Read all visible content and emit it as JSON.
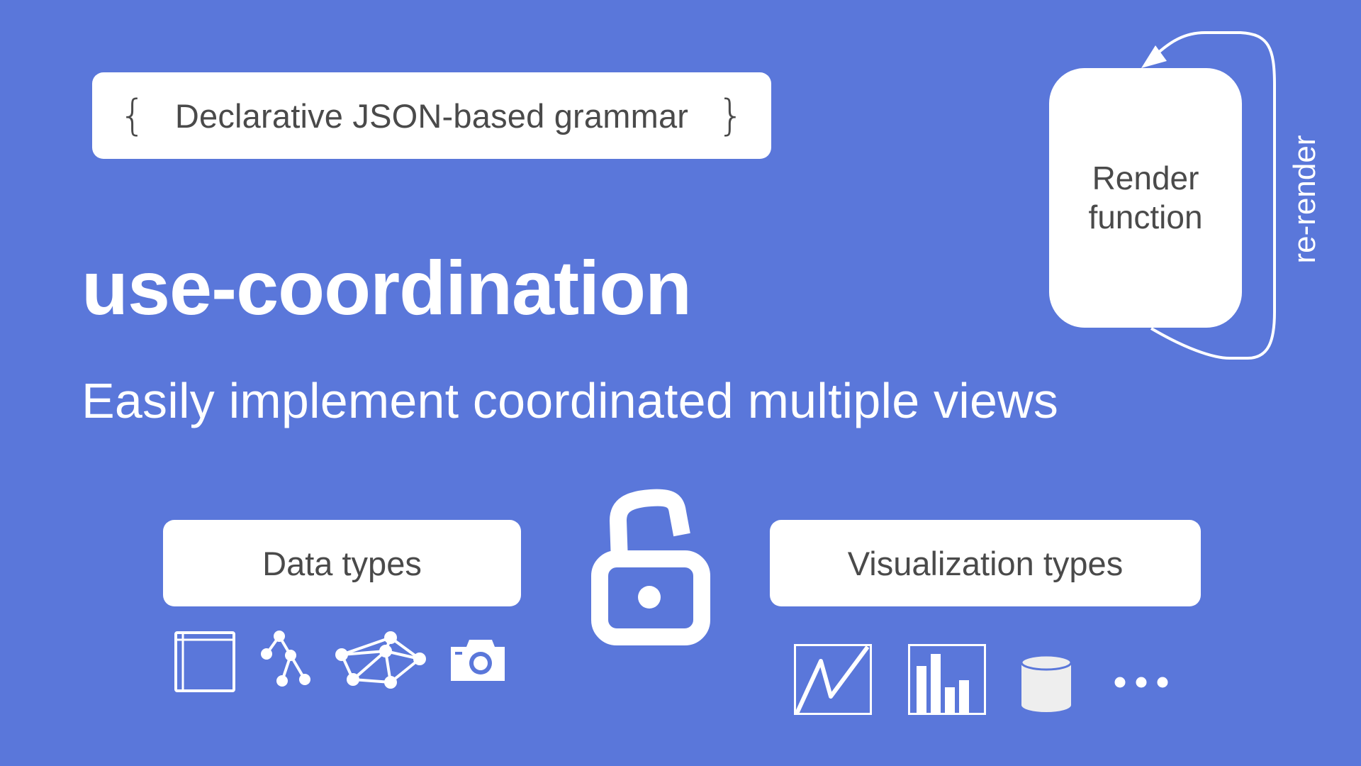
{
  "colors": {
    "background": "#5a77da",
    "card": "#ffffff",
    "card_text": "#4a4a4a",
    "foreground": "#ffffff",
    "cylinder_fill": "#eeeeee"
  },
  "grammar": {
    "open_brace": "{",
    "label": "Declarative JSON-based grammar",
    "close_brace": "}"
  },
  "title": "use-coordination",
  "subtitle": "Easily implement coordinated multiple views",
  "render": {
    "label_line1": "Render",
    "label_line2": "function",
    "loop_label": "re-render"
  },
  "center_icon": "unlocked-padlock-icon",
  "data_types": {
    "label": "Data types",
    "icons": [
      "table-icon",
      "tree-icon",
      "graph-network-icon",
      "camera-image-icon"
    ]
  },
  "visualization_types": {
    "label": "Visualization types",
    "icons": [
      "line-chart-icon",
      "bar-chart-icon",
      "cylinder-3d-icon",
      "ellipsis-icon"
    ]
  }
}
